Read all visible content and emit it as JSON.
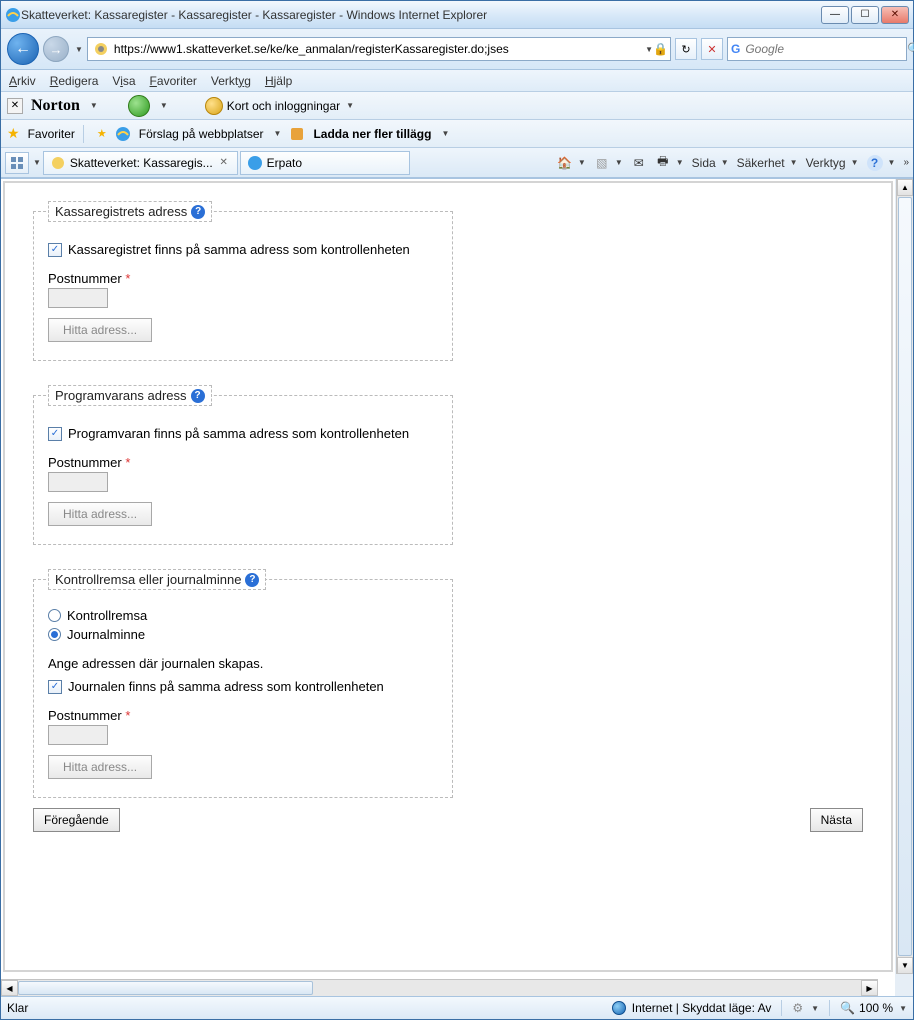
{
  "window": {
    "title": "Skatteverket: Kassaregister - Kassaregister - Kassaregister - Windows Internet Explorer"
  },
  "nav": {
    "url": "https://www1.skatteverket.se/ke/ke_anmalan/registerKassaregister.do;jses",
    "search_placeholder": "Google"
  },
  "menu": {
    "arkiv": "Arkiv",
    "redigera": "Redigera",
    "visa": "Visa",
    "favoriter": "Favoriter",
    "verktyg": "Verktyg",
    "hjalp": "Hjälp"
  },
  "norton": {
    "brand": "Norton",
    "kort": "Kort och inloggningar"
  },
  "favbar": {
    "favoriter": "Favoriter",
    "forslag": "Förslag på webbplatser",
    "ladda": "Ladda ner fler tillägg"
  },
  "tabs": {
    "t1": "Skatteverket: Kassaregis...",
    "t2": "Erpato"
  },
  "cmdbar": {
    "sida": "Sida",
    "sakerhet": "Säkerhet",
    "verktyg": "Verktyg"
  },
  "form": {
    "sec1_legend": "Kassaregistrets adress",
    "sec1_chk": "Kassaregistret finns på samma adress som kontrollenheten",
    "postnummer": "Postnummer",
    "hitta": "Hitta adress...",
    "sec2_legend": "Programvarans adress",
    "sec2_chk": "Programvaran finns på samma adress som kontrollenheten",
    "sec3_legend": "Kontrollremsa eller journalminne",
    "radio1": "Kontrollremsa",
    "radio2": "Journalminne",
    "sec3_text": "Ange adressen där journalen skapas.",
    "sec3_chk": "Journalen finns på samma adress som kontrollenheten",
    "prev": "Föregående",
    "next": "Nästa"
  },
  "status": {
    "klar": "Klar",
    "zone": "Internet | Skyddat läge: Av",
    "zoom": "100 %"
  }
}
